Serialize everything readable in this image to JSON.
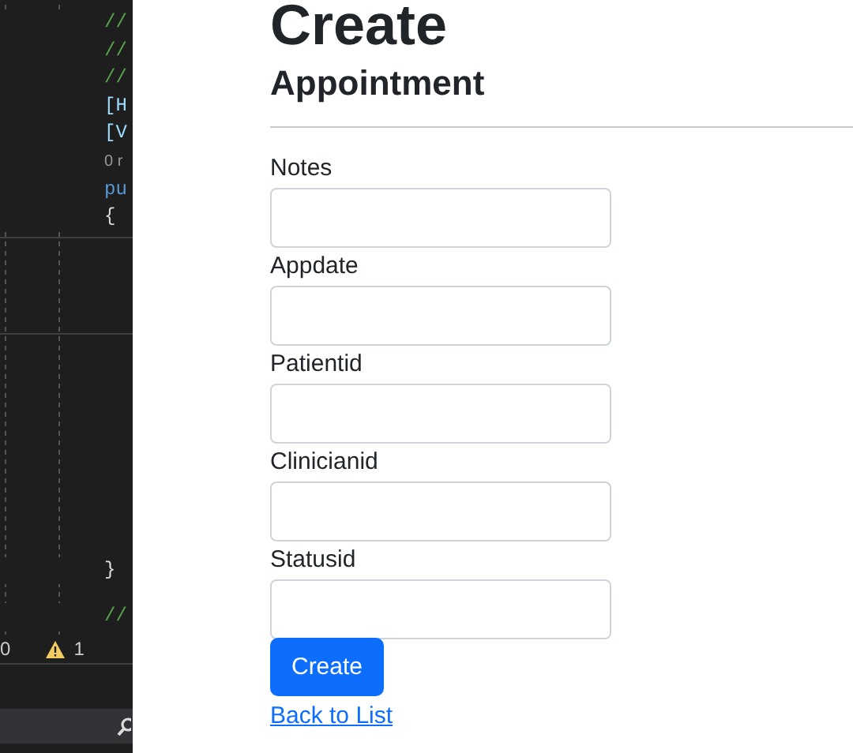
{
  "editor": {
    "code_lines": [
      {
        "text": "//",
        "kind": "comment"
      },
      {
        "text": "//",
        "kind": "comment"
      },
      {
        "text": "//",
        "kind": "comment"
      },
      {
        "text": "[H",
        "kind": "attribute"
      },
      {
        "text": "[V",
        "kind": "attribute"
      },
      {
        "text": "0 r",
        "kind": "codelens"
      },
      {
        "text": "pu",
        "kind": "keyword"
      },
      {
        "text": "{",
        "kind": "punct"
      }
    ],
    "bottom_lines": [
      {
        "text": "}",
        "kind": "punct"
      },
      {
        "text": "//",
        "kind": "comment"
      }
    ],
    "status": {
      "errors": "0",
      "warnings": "1"
    }
  },
  "page": {
    "title": "Create",
    "subtitle": "Appointment",
    "fields": [
      {
        "label": "Notes"
      },
      {
        "label": "Appdate"
      },
      {
        "label": "Patientid"
      },
      {
        "label": "Clinicianid"
      },
      {
        "label": "Statusid"
      }
    ],
    "submit": "Create",
    "back_link": "Back to List"
  }
}
